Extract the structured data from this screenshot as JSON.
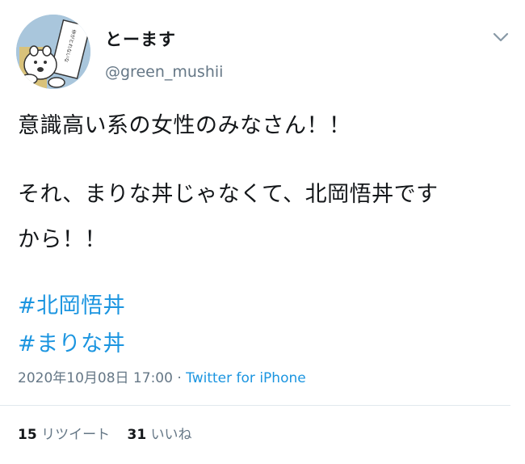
{
  "author": {
    "display_name": "とーます",
    "handle": "@green_mushii",
    "avatar_text": "仲がとれないな"
  },
  "tweet": {
    "lines": [
      "意識高い系の女性のみなさん！！",
      "それ、まりな丼じゃなくて、北岡悟丼です",
      "から！！"
    ],
    "hashtags": [
      "#北岡悟丼",
      "#まりな丼"
    ]
  },
  "meta": {
    "timestamp": "2020年10月08日 17:00",
    "separator": " · ",
    "source": "Twitter for iPhone"
  },
  "stats": {
    "retweets_count": "15",
    "retweets_label": "リツイート",
    "likes_count": "31",
    "likes_label": "いいね"
  },
  "colors": {
    "link": "#1b95e0",
    "secondary": "#657786",
    "text": "#14171a",
    "divider": "#e1e8ed"
  },
  "icons": {
    "caret": "chevron-down-icon"
  }
}
